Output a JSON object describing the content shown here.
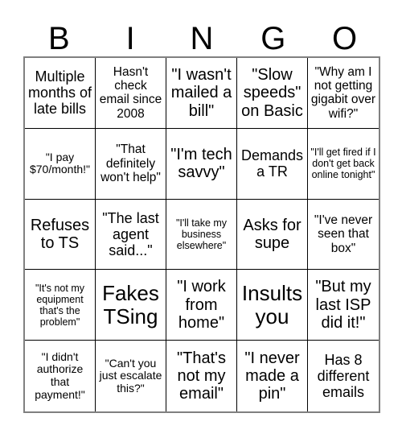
{
  "card": {
    "header_letters": [
      "B",
      "I",
      "N",
      "G",
      "O"
    ],
    "grid_size": 5,
    "colors": {
      "background": "#ffffff",
      "text": "#000000",
      "cell_border": "#000000",
      "outer_border": "#808080"
    },
    "rows": [
      [
        {
          "text": "Multiple months of late bills",
          "size": "sz-l"
        },
        {
          "text": "Hasn't check email since 2008",
          "size": "sz-m"
        },
        {
          "text": "\"I wasn't mailed a bill\"",
          "size": "sz-xl"
        },
        {
          "text": "\"Slow speeds\" on Basic",
          "size": "sz-xl"
        },
        {
          "text": "\"Why am I not getting gigabit over wifi?\"",
          "size": "sz-m"
        }
      ],
      [
        {
          "text": "\"I pay $70/month!\"",
          "size": "sz-s"
        },
        {
          "text": "\"That definitely won't help\"",
          "size": "sz-m"
        },
        {
          "text": "\"I'm tech savvy\"",
          "size": "sz-xl"
        },
        {
          "text": "Demands a TR",
          "size": "sz-l"
        },
        {
          "text": "\"I'll get fired if I don't get back online tonight\"",
          "size": "sz-xs"
        }
      ],
      [
        {
          "text": "Refuses to TS",
          "size": "sz-xl"
        },
        {
          "text": "\"The last agent said...\"",
          "size": "sz-l"
        },
        {
          "text": "\"I'll take my business elsewhere\"",
          "size": "sz-xs"
        },
        {
          "text": "Asks for supe",
          "size": "sz-xl"
        },
        {
          "text": "\"I've never seen that box\"",
          "size": "sz-m"
        }
      ],
      [
        {
          "text": "\"It's not my equipment that's the problem\"",
          "size": "sz-xs"
        },
        {
          "text": "Fakes TSing",
          "size": "sz-xxl"
        },
        {
          "text": "\"I work from home\"",
          "size": "sz-xl"
        },
        {
          "text": "Insults you",
          "size": "sz-xxl"
        },
        {
          "text": "\"But my last ISP did it!\"",
          "size": "sz-xl"
        }
      ],
      [
        {
          "text": "\"I didn't authorize that payment!\"",
          "size": "sz-s"
        },
        {
          "text": "\"Can't you just escalate this?\"",
          "size": "sz-s"
        },
        {
          "text": "\"That's not my email\"",
          "size": "sz-xl"
        },
        {
          "text": "\"I never made a pin\"",
          "size": "sz-xl"
        },
        {
          "text": "Has 8 different emails",
          "size": "sz-l"
        }
      ]
    ]
  }
}
